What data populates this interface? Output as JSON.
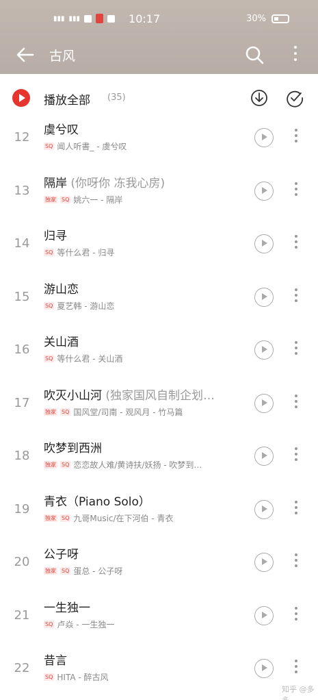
{
  "status_bar": {
    "time": "10:17",
    "battery": "30%"
  },
  "header": {
    "title": "古风",
    "back_icon": "arrow-left-icon",
    "search_icon": "search-icon",
    "more_icon": "more-vertical-icon"
  },
  "play_all": {
    "label": "播放全部",
    "count": "(35)"
  },
  "songs": [
    {
      "num": "12",
      "title": "虞兮叹",
      "subtitle": "",
      "exclusive": false,
      "artist": "闻人听書_ - 虞兮叹"
    },
    {
      "num": "13",
      "title": "隔岸",
      "subtitle": "(你呀你 冻我心房)",
      "exclusive": true,
      "artist": "姚六一 - 隔岸"
    },
    {
      "num": "14",
      "title": "归寻",
      "subtitle": "",
      "exclusive": false,
      "artist": "等什么君 - 归寻"
    },
    {
      "num": "15",
      "title": "游山恋",
      "subtitle": "",
      "exclusive": false,
      "artist": "夏艺韩 - 游山恋"
    },
    {
      "num": "16",
      "title": "关山酒",
      "subtitle": "",
      "exclusive": false,
      "artist": "等什么君 - 关山酒"
    },
    {
      "num": "17",
      "title": "吹灭小山河",
      "subtitle": "(独家国风自制企划…",
      "exclusive": true,
      "artist": "国风堂/司南 - 观风月 - 竹马篇"
    },
    {
      "num": "18",
      "title": "吹梦到西洲",
      "subtitle": "",
      "exclusive": true,
      "artist": "恋恋故人难/黄诗扶/妖扬 - 吹梦到…"
    },
    {
      "num": "19",
      "title": "青衣（Piano Solo）",
      "subtitle": "",
      "exclusive": true,
      "artist": "九哥Music/在下河伯 - 青衣"
    },
    {
      "num": "20",
      "title": "公子呀",
      "subtitle": "",
      "exclusive": true,
      "artist": "蛋总 - 公子呀"
    },
    {
      "num": "21",
      "title": "一生独一",
      "subtitle": "",
      "exclusive": false,
      "artist": "卢焱 - 一生独一"
    },
    {
      "num": "22",
      "title": "昔言",
      "subtitle": "",
      "exclusive": false,
      "artist": "HITA - 醉古风"
    }
  ],
  "tags": {
    "exclusive": "独家",
    "quality": "SQ"
  },
  "watermark": "知乎 @多多",
  "colors": {
    "accent": "#e6352f",
    "header_bg": "#bdb3ac"
  }
}
